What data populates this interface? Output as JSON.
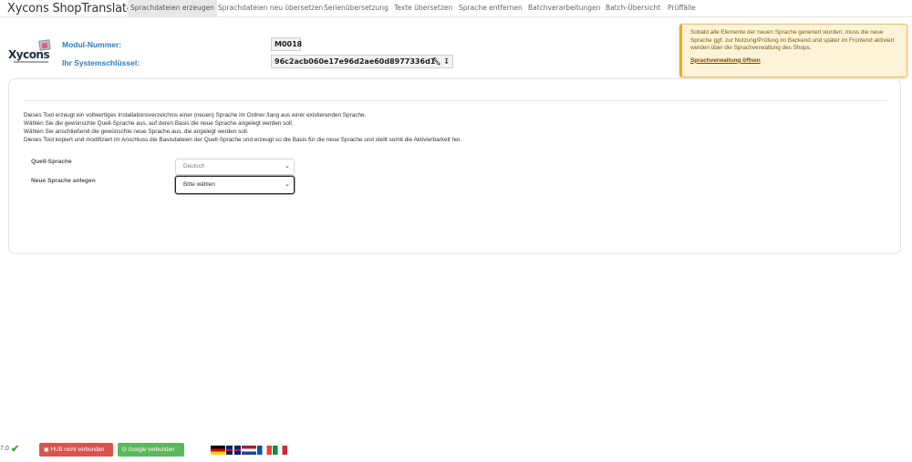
{
  "app": {
    "title": "Xycons ShopTranslator"
  },
  "nav": {
    "items": [
      {
        "label": "Sprachdateien erzeugen",
        "active": true
      },
      {
        "label": "Sprachdateien neu übersetzen"
      },
      {
        "label": "Serienübersetzung"
      },
      {
        "label": "Texte übersetzen"
      },
      {
        "label": "Sprache entfernen"
      },
      {
        "label": "Batchverarbeitungen"
      },
      {
        "label": "Batch-Übersicht"
      },
      {
        "label": "Prüffälle"
      }
    ]
  },
  "logo": {
    "text": "Xycons"
  },
  "module": {
    "number_label": "Modul-Nummer:",
    "number_value": "M0018",
    "key_label": "Ihr Systemschlüssel:",
    "key_value": "96c2acb060e17e96d2ae60d8977336d1"
  },
  "alert": {
    "text": "Sobald alle Elemente der neuen Sprache generiert wurden, muss die neue Sprache ggf. zur Nutzung/Prüfung im Backend und später im Frontend aktiviert werden über die Sprachverwaltung des Shops.",
    "link": "Sprachverwaltung öffnen"
  },
  "description": {
    "line1": "Dieses Tool erzeugt ein vollwertiges Installationsverzeichnis einer (neuen) Sprache im Ordner /lang aus einer existierenden Sprache.",
    "line2": "Wählen Sie die gewünschte Quell-Sprache aus, auf deren Basis die neue Sprache angelegt werden soll.",
    "line3": "Wählen Sie anschließend die gewünschte neue Sprache aus, die angelegt werden soll.",
    "line4": "Dieses Tool kopiert und modifiziert im Anschluss die Basisdateien der Quell-Sprache und erzeugt so die Basis für die neue Sprache und stellt somit die Aktivierbarkeit her."
  },
  "form": {
    "source_label": "Quell-Sprache",
    "source_value": "Deutsch",
    "new_label": "Neue Sprache anlegen",
    "new_value": "Bitte wählen"
  },
  "footer": {
    "version": "7.0",
    "hub_button": "HUB nicht verbunden",
    "google_button": "Google verbunden",
    "flags": [
      "de",
      "gb",
      "nl",
      "fr",
      "it"
    ]
  },
  "colors": {
    "accent": "#2a7bc0",
    "danger": "#d9534f",
    "success": "#5cb85c",
    "warning_bg": "#fdf3d8"
  }
}
